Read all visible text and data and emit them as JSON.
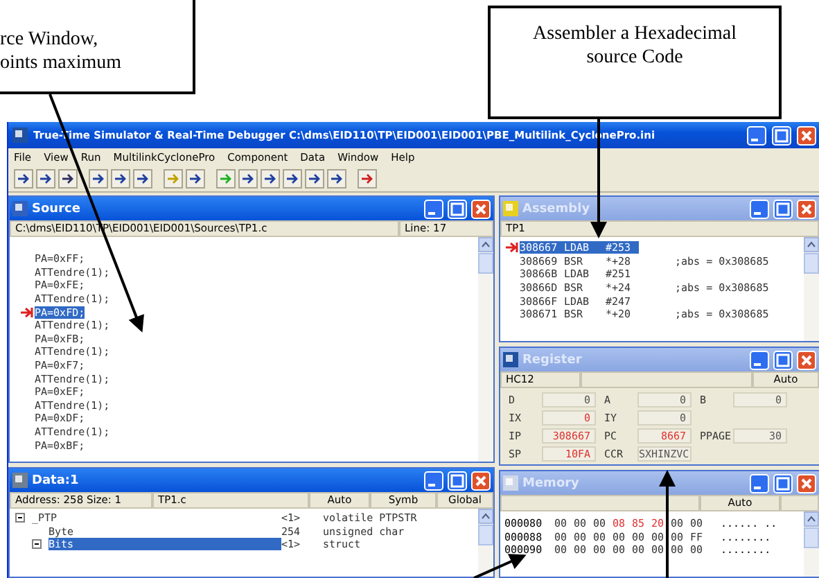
{
  "callouts": [
    {
      "lines": [
        "rce Window,",
        "oints maximum"
      ]
    },
    {
      "lines": [
        "Assembler a Hexadecimal",
        "source Code"
      ]
    }
  ],
  "window": {
    "title": "True-Time Simulator & Real-Time Debugger   C:\\dms\\EID110\\TP\\EID001\\EID001\\PBE_Multilink_CyclonePro.ini"
  },
  "menu": [
    "File",
    "View",
    "Run",
    "MultilinkCyclonePro",
    "Component",
    "Data",
    "Window",
    "Help"
  ],
  "source": {
    "title": "Source",
    "active": true,
    "path": "C:\\dms\\EID110\\TP\\EID001\\EID001\\Sources\\TP1.c",
    "line": "Line: 17",
    "lines": [
      {
        "text": "PA=0xFF;",
        "current": false
      },
      {
        "text": "ATTendre(1);",
        "current": false
      },
      {
        "text": "PA=0xFE;",
        "current": false
      },
      {
        "text": "ATTendre(1);",
        "current": false
      },
      {
        "text": "PA=0xFD;",
        "current": true
      },
      {
        "text": "ATTendre(1);",
        "current": false
      },
      {
        "text": "PA=0xFB;",
        "current": false
      },
      {
        "text": "ATTendre(1);",
        "current": false
      },
      {
        "text": "PA=0xF7;",
        "current": false
      },
      {
        "text": "ATTendre(1);",
        "current": false
      },
      {
        "text": "PA=0xEF;",
        "current": false
      },
      {
        "text": "ATTendre(1);",
        "current": false
      },
      {
        "text": "PA=0xDF;",
        "current": false
      },
      {
        "text": "ATTendre(1);",
        "current": false
      },
      {
        "text": "PA=0xBF;",
        "current": false
      }
    ]
  },
  "assembly": {
    "title": "Assembly",
    "active": false,
    "header": "TP1",
    "rows": [
      {
        "address": "308667",
        "mnemonic": "LDAB",
        "operand": "#253",
        "comment": "",
        "current": true
      },
      {
        "address": "308669",
        "mnemonic": "BSR",
        "operand": "*+28",
        "comment": ";abs = 0x308685",
        "current": false
      },
      {
        "address": "30866B",
        "mnemonic": "LDAB",
        "operand": "#251",
        "comment": "",
        "current": false
      },
      {
        "address": "30866D",
        "mnemonic": "BSR",
        "operand": "*+24",
        "comment": ";abs = 0x308685",
        "current": false
      },
      {
        "address": "30866F",
        "mnemonic": "LDAB",
        "operand": "#247",
        "comment": "",
        "current": false
      },
      {
        "address": "308671",
        "mnemonic": "BSR",
        "operand": "*+20",
        "comment": ";abs = 0x308685",
        "current": false
      }
    ]
  },
  "register": {
    "title": "Register",
    "active": false,
    "cpu": "HC12",
    "mode": "Auto",
    "rows": [
      [
        {
          "label": "D",
          "value": "0",
          "changed": false
        },
        {
          "label": "A",
          "value": "0",
          "changed": false
        },
        {
          "label": "B",
          "value": "0",
          "changed": false
        }
      ],
      [
        {
          "label": "IX",
          "value": "0",
          "changed": true
        },
        {
          "label": "IY",
          "value": "0",
          "changed": false
        }
      ],
      [
        {
          "label": "IP",
          "value": "308667",
          "changed": true
        },
        {
          "label": "PC",
          "value": "8667",
          "changed": true
        },
        {
          "label": "PPAGE",
          "value": "30",
          "changed": false
        }
      ],
      [
        {
          "label": "SP",
          "value": "10FA",
          "changed": true
        },
        {
          "label": "CCR",
          "value": "SXHINZVC",
          "changed": false
        }
      ]
    ]
  },
  "data": {
    "title": "Data:1",
    "active": true,
    "header": [
      "Address: 258  Size: 1",
      "TP1.c",
      "Auto",
      "Symb",
      "Global"
    ],
    "rows": [
      {
        "name": "_PTP",
        "value": "<1>",
        "type": "volatile PTPSTR",
        "expanded": true,
        "selected": false,
        "children": [
          {
            "name": "Byte",
            "value": "254",
            "type": "unsigned char",
            "selected": false
          },
          {
            "name": "Bits",
            "value": "<1>",
            "type": "struct",
            "expanded": true,
            "selected": true
          }
        ]
      }
    ]
  },
  "memory": {
    "title": "Memory",
    "active": false,
    "mode": "Auto",
    "rows": [
      {
        "address": "000080",
        "bytes": [
          {
            "v": "00",
            "changed": false
          },
          {
            "v": "00",
            "changed": false
          },
          {
            "v": "00",
            "changed": false
          },
          {
            "v": "08",
            "changed": true
          },
          {
            "v": "85",
            "changed": true
          },
          {
            "v": "20",
            "changed": true
          },
          {
            "v": "00",
            "changed": false
          },
          {
            "v": "00",
            "changed": false
          }
        ],
        "ascii": "...... .."
      },
      {
        "address": "000088",
        "bytes": [
          {
            "v": "00",
            "changed": false
          },
          {
            "v": "00",
            "changed": false
          },
          {
            "v": "00",
            "changed": false
          },
          {
            "v": "00",
            "changed": false
          },
          {
            "v": "00",
            "changed": false
          },
          {
            "v": "00",
            "changed": false
          },
          {
            "v": "00",
            "changed": false
          },
          {
            "v": "FF",
            "changed": false
          }
        ],
        "ascii": "........"
      },
      {
        "address": "000090",
        "bytes": [
          {
            "v": "00",
            "changed": false
          },
          {
            "v": "00",
            "changed": false
          },
          {
            "v": "00",
            "changed": false
          },
          {
            "v": "00",
            "changed": false
          },
          {
            "v": "00",
            "changed": false
          },
          {
            "v": "00",
            "changed": false
          },
          {
            "v": "00",
            "changed": false
          },
          {
            "v": "00",
            "changed": false
          }
        ],
        "ascii": "........"
      }
    ]
  }
}
